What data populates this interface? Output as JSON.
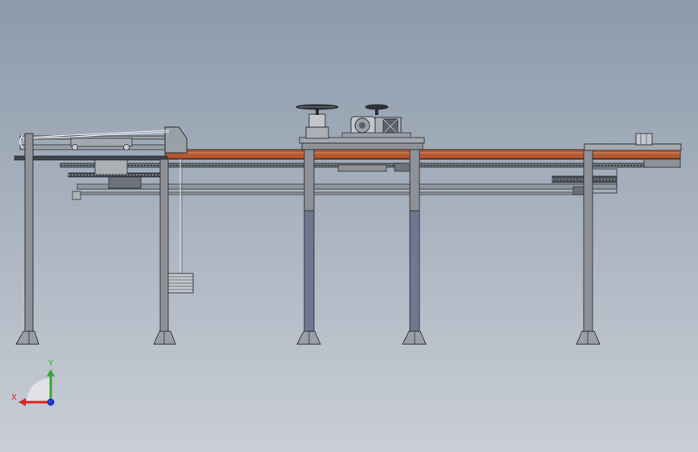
{
  "view": {
    "background_top": "#8d9aab",
    "background_bottom": "#c9ced6"
  },
  "colors": {
    "steel": "#8e9298",
    "steel_dark": "#4a4f57",
    "column_blue": "#6f7890",
    "belt": "#b35a35",
    "belt_dark": "#7a3416",
    "outline": "#2b2e33",
    "axis_x": "#e0231d",
    "axis_y": "#2fae2f",
    "axis_z": "#1d3fd8"
  },
  "triad": {
    "x_label": "X",
    "y_label": "Y"
  }
}
